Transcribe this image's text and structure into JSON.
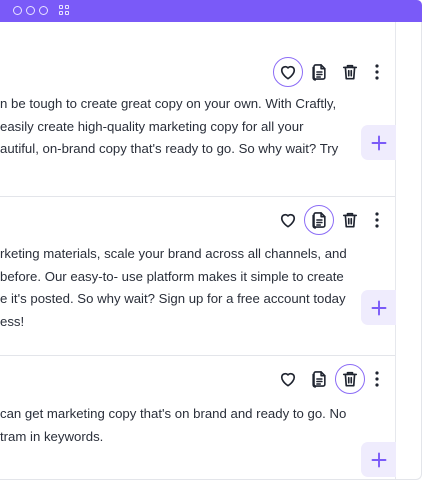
{
  "window": {
    "titlebar_icons": [
      "window-dot-icon",
      "window-dot-icon",
      "window-dot-icon",
      "grid-icon"
    ]
  },
  "colors": {
    "titlebar": "#7a5af8",
    "accent": "#8b6cf6",
    "add_button_bg": "#efecfd"
  },
  "cards": [
    {
      "lines": [
        "n be tough to create great copy on your own. With Craftly,",
        "easily create high-quality marketing copy for all your",
        "autiful, on-brand copy that's ready to go. So why wait? Try"
      ],
      "active_action": "like"
    },
    {
      "lines": [
        "rketing materials, scale your brand across all channels, and",
        "before. Our easy-to- use platform makes it simple to create",
        "e it's posted. So why wait? Sign up for a free account today",
        "ess!"
      ],
      "active_action": "copy"
    },
    {
      "lines": [
        "can get marketing copy that's on brand and ready to go. No",
        "tram in keywords."
      ],
      "active_action": "delete"
    }
  ],
  "actions": {
    "like_icon": "heart-icon",
    "copy_icon": "copy-document-icon",
    "delete_icon": "trash-icon",
    "more_icon": "more-vertical-icon",
    "add_icon": "plus-icon"
  }
}
